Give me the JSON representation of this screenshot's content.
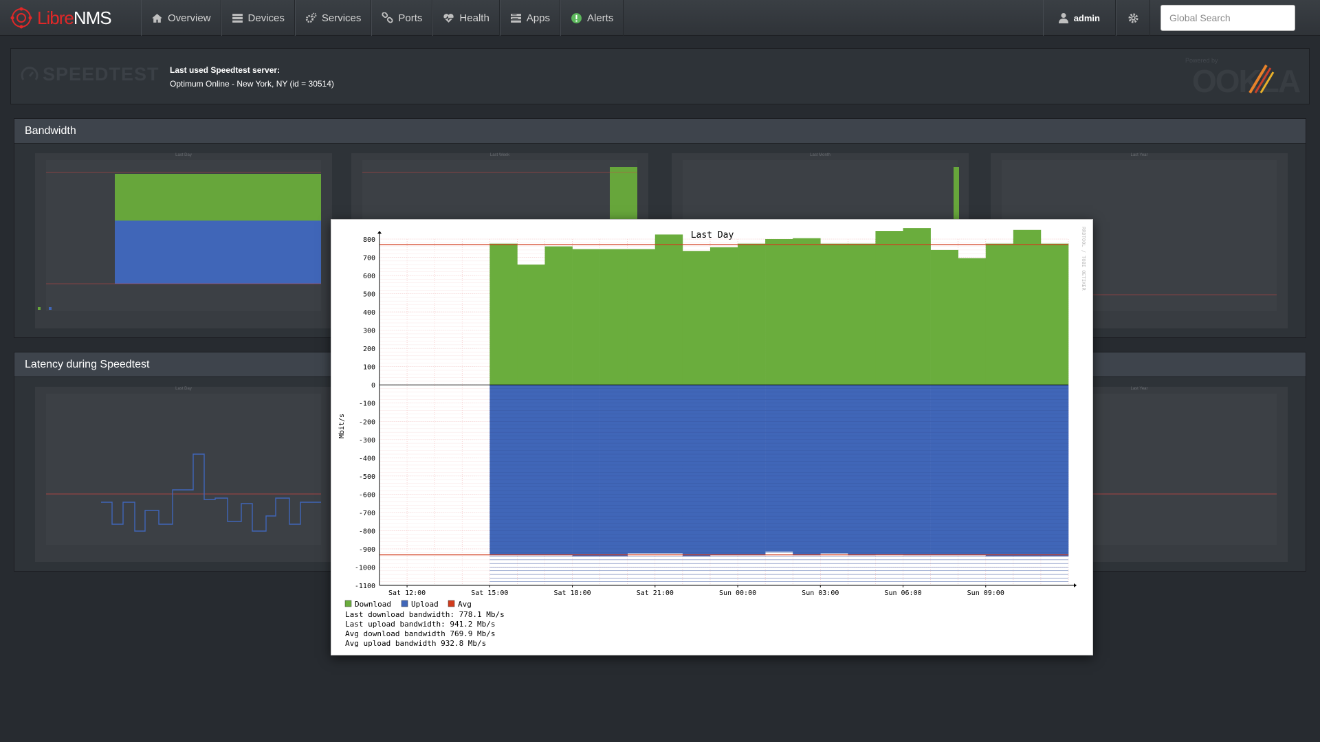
{
  "app": {
    "name_part1": "Libre",
    "name_part2": "NMS"
  },
  "nav": {
    "items": [
      {
        "label": "Overview",
        "icon": "home-icon"
      },
      {
        "label": "Devices",
        "icon": "server-icon"
      },
      {
        "label": "Services",
        "icon": "cogs-icon"
      },
      {
        "label": "Ports",
        "icon": "link-icon"
      },
      {
        "label": "Health",
        "icon": "heartbeat-icon"
      },
      {
        "label": "Apps",
        "icon": "tasks-icon"
      },
      {
        "label": "Alerts",
        "icon": "exclamation-circle-icon"
      }
    ],
    "user": "admin",
    "search_placeholder": "Global Search"
  },
  "speedtest": {
    "logo_text": "SPEEDTEST",
    "server_label": "Last used Speedtest server:",
    "server_value": "Optimum Online - New York, NY (id = 30514)",
    "powered_by": "Powered by",
    "ookla_text": "OOKLA"
  },
  "panels": {
    "bandwidth_title": "Bandwidth",
    "latency_title": "Latency during Speedtest"
  },
  "thumbnail_titles": [
    "Last Day",
    "Last Week",
    "Last Month",
    "Last Year"
  ],
  "colors": {
    "download": "#6aad3d",
    "upload": "#4066b8",
    "avg": "#d23c1e",
    "accent": "#e02828"
  },
  "chart_data": {
    "type": "area",
    "title": "Last Day",
    "ylabel": "Mbit/s",
    "ylim": [
      -1100,
      800
    ],
    "yticks": [
      800,
      700,
      600,
      500,
      400,
      300,
      200,
      100,
      0,
      -100,
      -200,
      -300,
      -400,
      -500,
      -600,
      -700,
      -800,
      -900,
      -1000,
      -1100
    ],
    "xticks": [
      "Sat 12:00",
      "Sat 15:00",
      "Sat 18:00",
      "Sat 21:00",
      "Sun 00:00",
      "Sun 03:00",
      "Sun 06:00",
      "Sun 09:00"
    ],
    "x_start": "Sat 11:00",
    "x_step_hours": 1,
    "watermark": "RRDTOOL / TOBI OETIKER",
    "series": [
      {
        "name": "Download",
        "values": [
          null,
          null,
          null,
          null,
          775,
          660,
          760,
          745,
          745,
          745,
          825,
          735,
          755,
          775,
          800,
          805,
          775,
          775,
          845,
          860,
          740,
          695,
          775,
          850,
          775
        ]
      },
      {
        "name": "Upload",
        "values": [
          null,
          null,
          null,
          null,
          -935,
          -935,
          -935,
          -940,
          -940,
          -925,
          -925,
          -940,
          -935,
          -935,
          -915,
          -935,
          -925,
          -935,
          -930,
          -935,
          -935,
          -935,
          -940,
          -940,
          -940
        ]
      }
    ],
    "avg_download": 769.9,
    "avg_upload": -932.8,
    "legend": [
      {
        "name": "Download",
        "color": "#6aad3d"
      },
      {
        "name": "Upload",
        "color": "#4066b8"
      },
      {
        "name": "Avg",
        "color": "#d23c1e"
      }
    ],
    "stats": [
      "Last download bandwidth: 778.1 Mb/s",
      "Last upload bandwidth: 941.2 Mb/s",
      "Avg download bandwidth 769.9 Mb/s",
      "Avg upload bandwidth 932.8 Mb/s"
    ]
  }
}
